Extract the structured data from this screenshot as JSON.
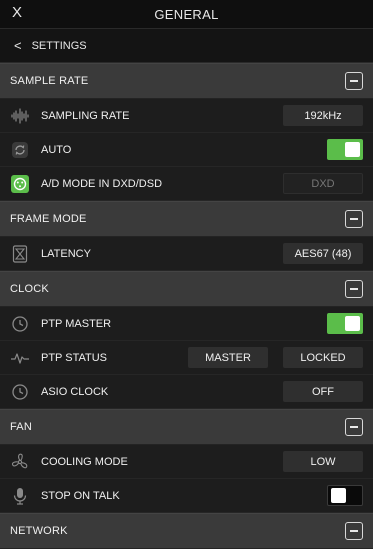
{
  "window": {
    "title": "GENERAL",
    "close_label": "X"
  },
  "nav": {
    "back_chevron": "<",
    "back_label": "SETTINGS"
  },
  "sections": {
    "sample_rate": {
      "label": "SAMPLE RATE",
      "sampling_rate": {
        "label": "SAMPLING RATE",
        "value": "192kHz",
        "icon": "waveform-icon"
      },
      "auto": {
        "label": "AUTO",
        "state": "on",
        "icon": "auto-sync-icon"
      },
      "ad_mode": {
        "label": "A/D MODE IN DXD/DSD",
        "value": "DXD",
        "icon": "xlr-connector-icon"
      }
    },
    "frame_mode": {
      "label": "FRAME MODE",
      "latency": {
        "label": "LATENCY",
        "value": "AES67 (48)",
        "icon": "hourglass-icon"
      }
    },
    "clock": {
      "label": "CLOCK",
      "ptp_master": {
        "label": "PTP MASTER",
        "state": "on",
        "icon": "clock-icon"
      },
      "ptp_status": {
        "label": "PTP STATUS",
        "value_left": "MASTER",
        "value_right": "LOCKED",
        "icon": "pulse-icon"
      },
      "asio_clock": {
        "label": "ASIO CLOCK",
        "value": "OFF",
        "icon": "clock-icon"
      }
    },
    "fan": {
      "label": "FAN",
      "cooling_mode": {
        "label": "COOLING MODE",
        "value": "LOW",
        "icon": "fan-icon"
      },
      "stop_on_talk": {
        "label": "STOP ON TALK",
        "state": "off",
        "icon": "microphone-icon"
      }
    },
    "network": {
      "label": "NETWORK"
    }
  },
  "colors": {
    "accent_green": "#5bbd4a",
    "section_bg": "#3a3a3a",
    "row_bg": "#1d1d1d",
    "value_bg": "#2f2f2f",
    "titlebar_bg": "#0f0f0f"
  }
}
